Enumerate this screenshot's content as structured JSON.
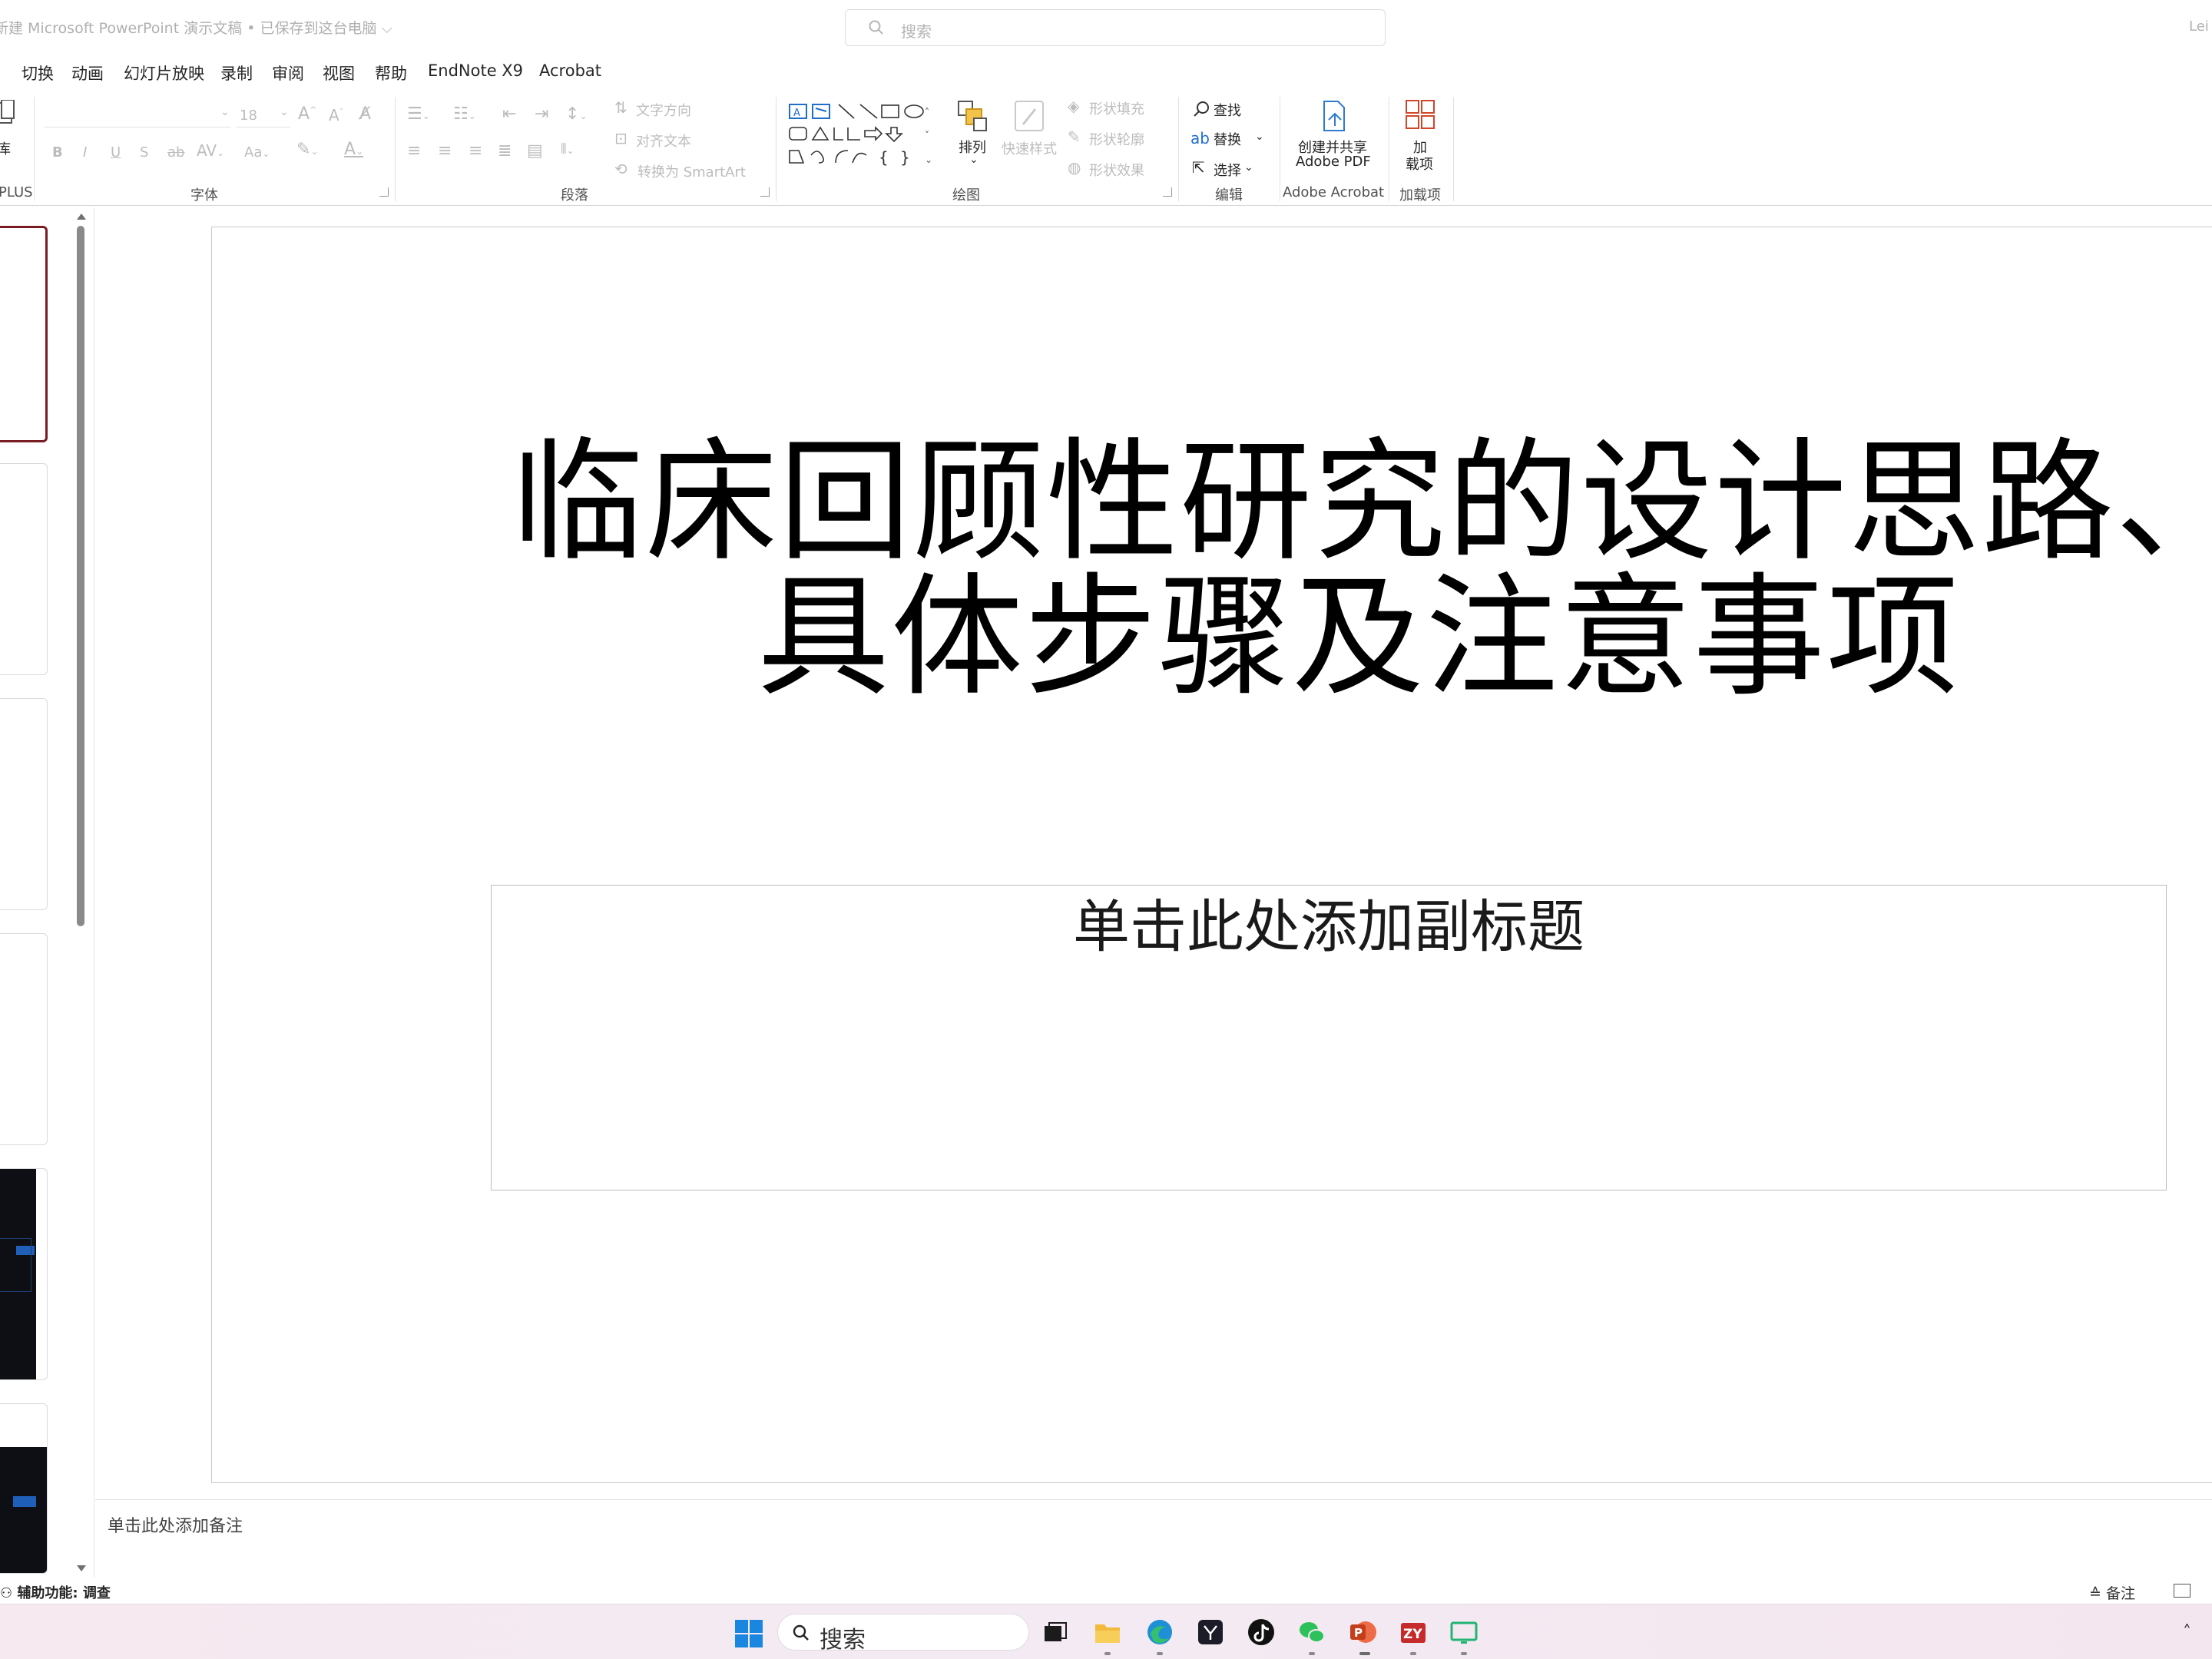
{
  "titlebar": {
    "doc_title": "新建 Microsoft PowerPoint 演示文稿 • 已保存到这台电脑 ⌵",
    "search_placeholder": "搜索",
    "user": "Lei"
  },
  "menu": {
    "tabs": [
      "切换",
      "动画",
      "幻灯片放映",
      "录制",
      "审阅",
      "视图",
      "帮助",
      "EndNote X9",
      "Acrobat"
    ]
  },
  "ribbon": {
    "groups": {
      "plus": "PLUS",
      "font": "字体",
      "paragraph": "段落",
      "drawing": "绘图",
      "editing": "编辑",
      "acrobat": "Adobe Acrobat",
      "addins": "加载项"
    },
    "left_cut_label": "库",
    "font_size": "18",
    "text_direction": "文字方向",
    "align_text": "对齐文本",
    "convert_smartart": "转换为 SmartArt",
    "arrange": "排列",
    "quick_styles": "快速样式",
    "shape_fill": "形状填充",
    "shape_outline": "形状轮廓",
    "shape_effects": "形状效果",
    "find": "查找",
    "replace": "替换",
    "select": "选择",
    "create_pdf_line1": "创建并共享",
    "create_pdf_line2": "Adobe PDF",
    "addins_line1": "加",
    "addins_line2": "载项"
  },
  "slide": {
    "title_line1": "临床回顾性研究的设计思路、",
    "title_line2": "具体步骤及注意事项",
    "subtitle_placeholder": "单击此处添加副标题"
  },
  "notes": {
    "placeholder": "单击此处添加备注"
  },
  "status": {
    "accessibility": "辅助功能: 调查",
    "notes_button": "备注"
  },
  "taskbar": {
    "search_label": "搜索",
    "apps": [
      "task-view",
      "file-explorer",
      "edge",
      "app-cube",
      "tiktok",
      "wechat",
      "powerpoint",
      "zy-app",
      "screen-app"
    ]
  },
  "colors": {
    "active_thumb_border": "#7a1c24",
    "windows_blue": "#1a86e0",
    "powerpoint_red": "#c43e1c"
  }
}
